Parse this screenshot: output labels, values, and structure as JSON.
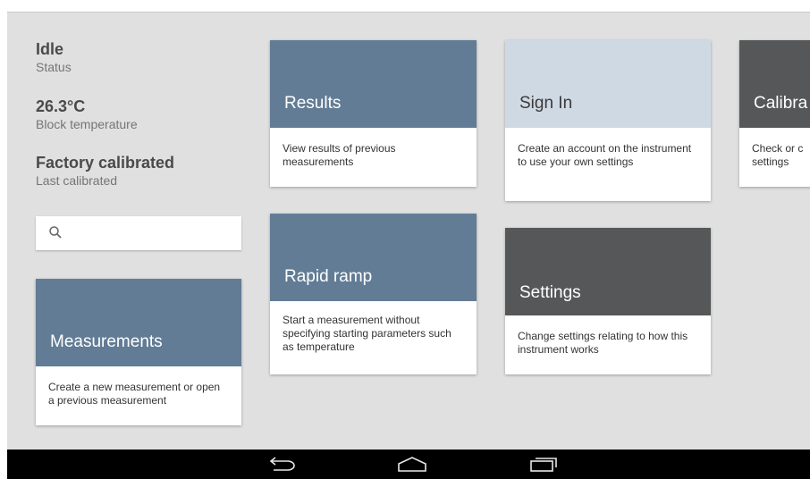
{
  "status": [
    {
      "value": "Idle",
      "label": "Status"
    },
    {
      "value": "26.3°C",
      "label": "Block temperature"
    },
    {
      "value": "Factory calibrated",
      "label": "Last calibrated"
    }
  ],
  "search": {
    "placeholder": "",
    "value": ""
  },
  "cards": {
    "measurements": {
      "title": "Measurements",
      "description": "Create a new measurement or open a previous measurement"
    },
    "results": {
      "title": "Results",
      "description": "View results of previous measurements"
    },
    "rapid_ramp": {
      "title": "Rapid ramp",
      "description": "Start a measurement without specifying starting parameters such as temperature"
    },
    "sign_in": {
      "title": "Sign In",
      "description": "Create an account on the instrument to use your own settings"
    },
    "settings": {
      "title": "Settings",
      "description": "Change settings relating to how this instrument works"
    },
    "calibration": {
      "title": "Calibra",
      "description": "Check or c settings"
    }
  },
  "colors": {
    "card_blue": "#627c95",
    "card_light": "#cfd9e4",
    "card_dark": "#555758",
    "screen_bg": "#e0e0e0"
  },
  "navbar": {
    "icons": [
      "back-icon",
      "home-icon",
      "recents-icon"
    ]
  }
}
